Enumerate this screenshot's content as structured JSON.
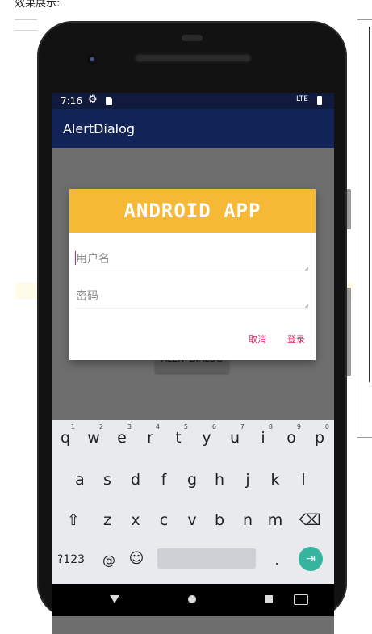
{
  "page": {
    "caption": "效果展示:"
  },
  "status_bar": {
    "time": "7:16",
    "signal": "LTE"
  },
  "app_bar": {
    "title": "AlertDialog"
  },
  "main_button": {
    "label": "ALERTDIALOG"
  },
  "dialog": {
    "banner_text": "ANDROID APP",
    "username_placeholder": "用户名",
    "password_placeholder": "密码",
    "cancel_label": "取消",
    "login_label": "登录"
  },
  "keyboard": {
    "row1": [
      {
        "key": "q",
        "hint": "1"
      },
      {
        "key": "w",
        "hint": "2"
      },
      {
        "key": "e",
        "hint": "3"
      },
      {
        "key": "r",
        "hint": "4"
      },
      {
        "key": "t",
        "hint": "5"
      },
      {
        "key": "y",
        "hint": "6"
      },
      {
        "key": "u",
        "hint": "7"
      },
      {
        "key": "i",
        "hint": "8"
      },
      {
        "key": "o",
        "hint": "9"
      },
      {
        "key": "p",
        "hint": "0"
      }
    ],
    "row2": [
      "a",
      "s",
      "d",
      "f",
      "g",
      "h",
      "j",
      "k",
      "l"
    ],
    "row3": [
      "z",
      "x",
      "c",
      "v",
      "b",
      "n",
      "m"
    ],
    "shift": "⇧",
    "delete": "⌫",
    "symbols": "?123",
    "at": "@",
    "emoji": "☺",
    "period": ".",
    "enter": "⇥"
  },
  "colors": {
    "app_bar": "#122358",
    "status_bar": "#0f1a3c",
    "banner": "#f6b935",
    "accent": "#e91e63",
    "enter_key": "#37b59f"
  },
  "icons": {
    "status": [
      "gear-icon",
      "sdcard-icon",
      "signal-icon",
      "battery-icon"
    ],
    "nav": [
      "back-icon",
      "home-icon",
      "recents-icon",
      "keyboard-switch-icon"
    ]
  }
}
